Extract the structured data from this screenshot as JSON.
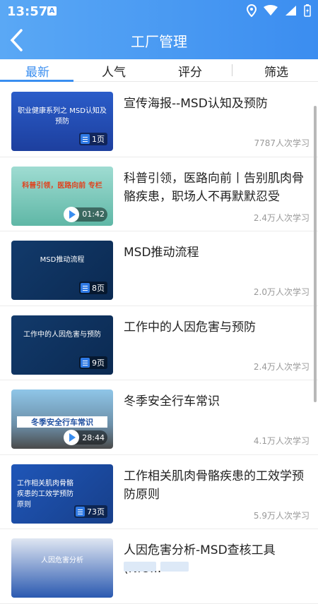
{
  "status": {
    "time": "13:57",
    "notif": "A"
  },
  "header": {
    "title": "工厂管理"
  },
  "tabs": [
    {
      "label": "最新",
      "active": true
    },
    {
      "label": "人气"
    },
    {
      "label": "评分"
    },
    {
      "label": "筛选"
    }
  ],
  "items": [
    {
      "title": "宣传海报--MSD认知及预防",
      "count": "7787人次学习",
      "badge": "1页",
      "badge_type": "doc",
      "thumb_text": "职业健康系列之 MSD认知及预防"
    },
    {
      "title": "科普引领，医路向前丨告别肌肉骨骼疾患，职场人不再默默忍受",
      "count": "2.4万人次学习",
      "badge": "01:42",
      "badge_type": "video",
      "thumb_text": "科普引领，医路向前 专栏"
    },
    {
      "title": "MSD推动流程",
      "count": "2.0万人次学习",
      "badge": "8页",
      "badge_type": "doc",
      "thumb_text": "MSD推动流程"
    },
    {
      "title": "工作中的人因危害与预防",
      "count": "2.4万人次学习",
      "badge": "9页",
      "badge_type": "doc",
      "thumb_text": "工作中的人因危害与预防"
    },
    {
      "title": "冬季安全行车常识",
      "count": "4.1万人次学习",
      "badge": "28:44",
      "badge_type": "video",
      "thumb_text": "冬季安全行车常识"
    },
    {
      "title": "工作相关肌肉骨骼疾患的工效学预防原则",
      "count": "5.9万人次学习",
      "badge": "73页",
      "badge_type": "doc",
      "thumb_text": "工作相关肌肉骨骼疾患的工效学预防原则"
    },
    {
      "title": "人因危害分析-MSD查核工具(NIO...",
      "count": "",
      "badge": "",
      "badge_type": "none",
      "thumb_text": "人因危害分析"
    }
  ],
  "colors": {
    "accent": "#3a8ef0",
    "header_start": "#5aa8f5",
    "header_end": "#3b8df0"
  }
}
